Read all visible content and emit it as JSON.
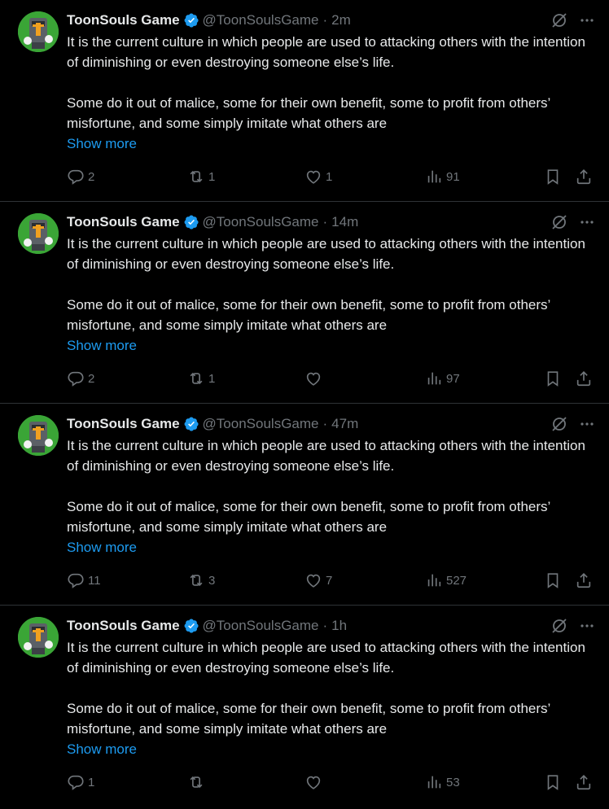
{
  "tweets": [
    {
      "author": "ToonSouls Game",
      "handle": "@ToonSoulsGame",
      "separator": "·",
      "time": "2m",
      "paragraphs": [
        "It is the current culture in which people are used to attacking others with the intention of diminishing or even destroying someone else’s life.",
        "Some do it out of malice, some for their own benefit, some to profit from others’ misfortune, and some simply imitate what others are"
      ],
      "show_more": "Show more",
      "replies": "2",
      "reposts": "1",
      "likes": "1",
      "views": "91"
    },
    {
      "author": "ToonSouls Game",
      "handle": "@ToonSoulsGame",
      "separator": "·",
      "time": "14m",
      "paragraphs": [
        "It is the current culture in which people are used to attacking others with the intention of diminishing or even destroying someone else’s life.",
        "Some do it out of malice, some for their own benefit, some to profit from others’ misfortune, and some simply imitate what others are"
      ],
      "show_more": "Show more",
      "replies": "2",
      "reposts": "1",
      "likes": "",
      "views": "97"
    },
    {
      "author": "ToonSouls Game",
      "handle": "@ToonSoulsGame",
      "separator": "·",
      "time": "47m",
      "paragraphs": [
        "It is the current culture in which people are used to attacking others with the intention of diminishing or even destroying someone else’s life.",
        "Some do it out of malice, some for their own benefit, some to profit from others’ misfortune, and some simply imitate what others are"
      ],
      "show_more": "Show more",
      "replies": "11",
      "reposts": "3",
      "likes": "7",
      "views": "527"
    },
    {
      "author": "ToonSouls Game",
      "handle": "@ToonSoulsGame",
      "separator": "·",
      "time": "1h",
      "paragraphs": [
        "It is the current culture in which people are used to attacking others with the intention of diminishing or even destroying someone else’s life.",
        "Some do it out of malice, some for their own benefit, some to profit from others’ misfortune, and some simply imitate what others are"
      ],
      "show_more": "Show more",
      "replies": "1",
      "reposts": "",
      "likes": "",
      "views": "53"
    }
  ],
  "icons": {
    "verified": "verified-badge-icon",
    "grok": "grok-icon",
    "more": "more-options-icon",
    "reply": "reply-icon",
    "repost": "repost-icon",
    "like": "like-icon",
    "views": "views-icon",
    "bookmark": "bookmark-icon",
    "share": "share-icon"
  },
  "colors": {
    "background": "#000000",
    "text": "#e7e9ea",
    "muted": "#71767b",
    "accent": "#1d9bf0",
    "divider": "#2f3336",
    "avatar_bg": "#3aa536"
  }
}
